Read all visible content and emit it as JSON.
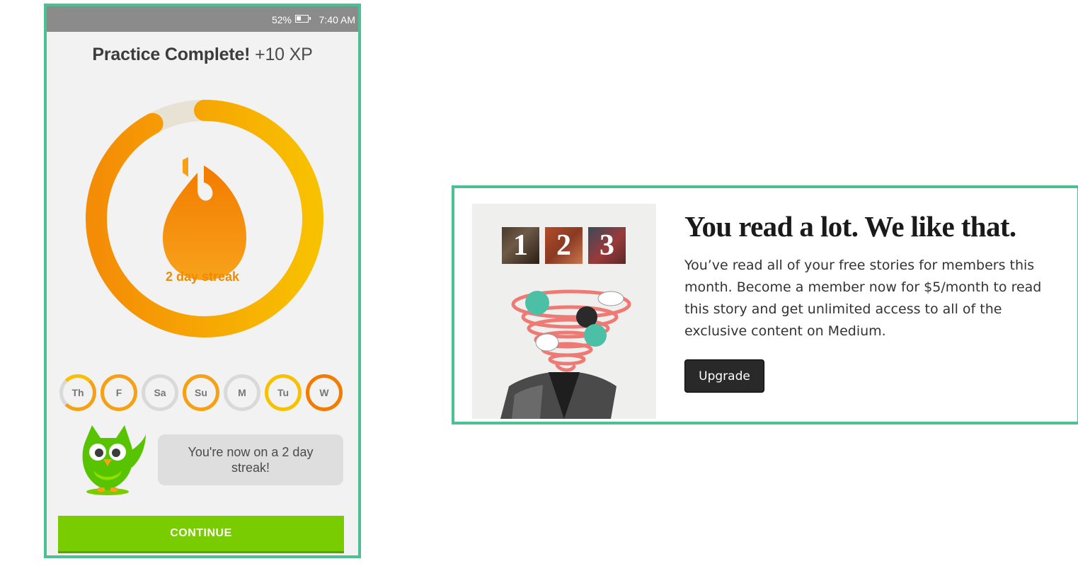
{
  "duolingo": {
    "status_bar": {
      "battery": "52%",
      "time": "7:40 AM"
    },
    "title": "Practice Complete!",
    "xp": "+10 XP",
    "streak_label": "2 day streak",
    "streak_progress": 0.92,
    "days": [
      {
        "label": "Th",
        "state": "partial"
      },
      {
        "label": "F",
        "state": "done"
      },
      {
        "label": "Sa",
        "state": "empty"
      },
      {
        "label": "Su",
        "state": "done"
      },
      {
        "label": "M",
        "state": "empty"
      },
      {
        "label": "Tu",
        "state": "done"
      },
      {
        "label": "W",
        "state": "done"
      }
    ],
    "bubble": "You're now on a 2 day streak!",
    "continue_label": "CONTINUE",
    "colors": {
      "green_button": "#78cc00",
      "ring_start": "#f48c06",
      "ring_end": "#f8c100",
      "frame": "#4cc093"
    }
  },
  "medium": {
    "tiles": [
      "1",
      "2",
      "3"
    ],
    "headline": "You read a lot. We like that.",
    "body": "You’ve read all of your free stories for members this month. Become a member now for $5/month to read this story and get unlimited access to all of the exclusive content on Medium.",
    "upgrade_label": "Upgrade",
    "colors": {
      "button": "#292929",
      "frame": "#4cc093"
    }
  }
}
